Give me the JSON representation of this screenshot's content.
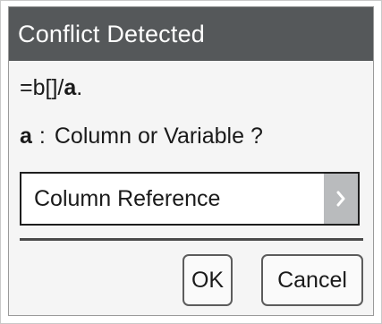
{
  "dialog": {
    "title": "Conflict Detected",
    "formula": {
      "prefix": "=b[]/",
      "bold_part": "a",
      "suffix": "."
    },
    "question": {
      "variable": "a",
      "separator": ":",
      "text": "Column or Variable ?"
    },
    "select": {
      "value": "Column Reference"
    },
    "buttons": {
      "ok_label": "OK",
      "cancel_label": "Cancel"
    }
  },
  "colors": {
    "title_bar": "#55585a",
    "title_text": "#ffffff",
    "dropdown_arrow_bg": "#b9bbbd",
    "dialog_bg": "#f5f5f5"
  },
  "icons": {
    "dropdown": "chevron-right-icon"
  }
}
